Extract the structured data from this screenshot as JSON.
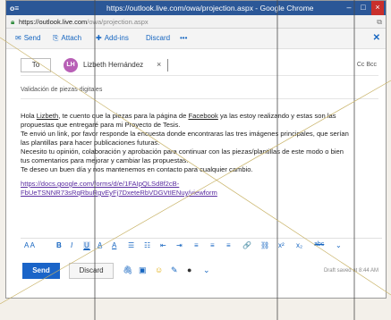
{
  "window": {
    "app_label": "o≡",
    "title": "https://outlook.live.com/owa/projection.aspx - Google Chrome",
    "minimize": "–",
    "maximize": "□",
    "close": "×"
  },
  "address_bar": {
    "url_host": "https://outlook.live.com",
    "url_path": "/owa/projection.aspx"
  },
  "toolbar": {
    "send_label": "Send",
    "attach_label": "Attach",
    "addins_label": "Add-ins",
    "discard_label": "Discard",
    "more_label": "•••"
  },
  "recipients": {
    "to_label": "To",
    "avatar_initials": "LH",
    "name": "Lizbeth Hernández",
    "remove": "×",
    "cc_bcc": "Cc  Bcc"
  },
  "subject": "Validación de piezas digitales",
  "body": {
    "line1_a": "Hola ",
    "line1_name": "Lizbeth",
    "line1_b": ", te cuento que la piezas para la página de ",
    "line1_fb": "Facebook",
    "line1_c": " ya las estoy realizando y estas son las",
    "line2": "propuestas que entregaré para mi Proyecto de Tesis.",
    "line3": "Te envió un link, por favor responde la encuesta donde encontraras las tres imágenes principales, que serían",
    "line4": "las plantillas para hacer publicaciones futuras.",
    "line5": "Necesito tu opinión, colaboración y aprobación para continuar con las piezas/plantillas de este modo o bien",
    "line6": "tus comentarios para mejorar y cambiar las propuestas.",
    "line7": "Te deseo un buen día y nos mantenemos en contacto para cualquier cambio.",
    "link1": "https://docs.google.com/forms/d/e/1FAIpQLSd8f2cB-",
    "link2": "FbUeTSNNR73sRqRbuRgvEyFj7DxeteRbVDGVtIENuy/viewform"
  },
  "format_bar": {
    "font_size": "A A",
    "grow": "A",
    "bold": "B",
    "italic": "I",
    "underline": "U",
    "highlight": "A̲",
    "color": "A",
    "bullets": "☰",
    "numbers": "☷",
    "outdent": "⇤",
    "indent": "⇥",
    "align_left": "≡",
    "align_center": "≡",
    "align_right": "≡",
    "link": "🔗",
    "unlink": "⛓",
    "superscript": "x²",
    "subscript": "x₂",
    "strike": "abc",
    "more": "⌄"
  },
  "actions": {
    "send_label": "Send",
    "discard_label": "Discard",
    "attach_icon": "🖇",
    "image_icon": "▣",
    "emoji_icon": "☺",
    "signature_icon": "✎",
    "addin_icon": "●",
    "more_icon": "⌄",
    "draft_status": "Draft saved at 8:44 AM"
  },
  "colors": {
    "titlebar": "#2b5797",
    "accent": "#1565c0",
    "send_button": "#1a64c8",
    "avatar": "#b85fb6",
    "link": "#5a2ca0"
  }
}
